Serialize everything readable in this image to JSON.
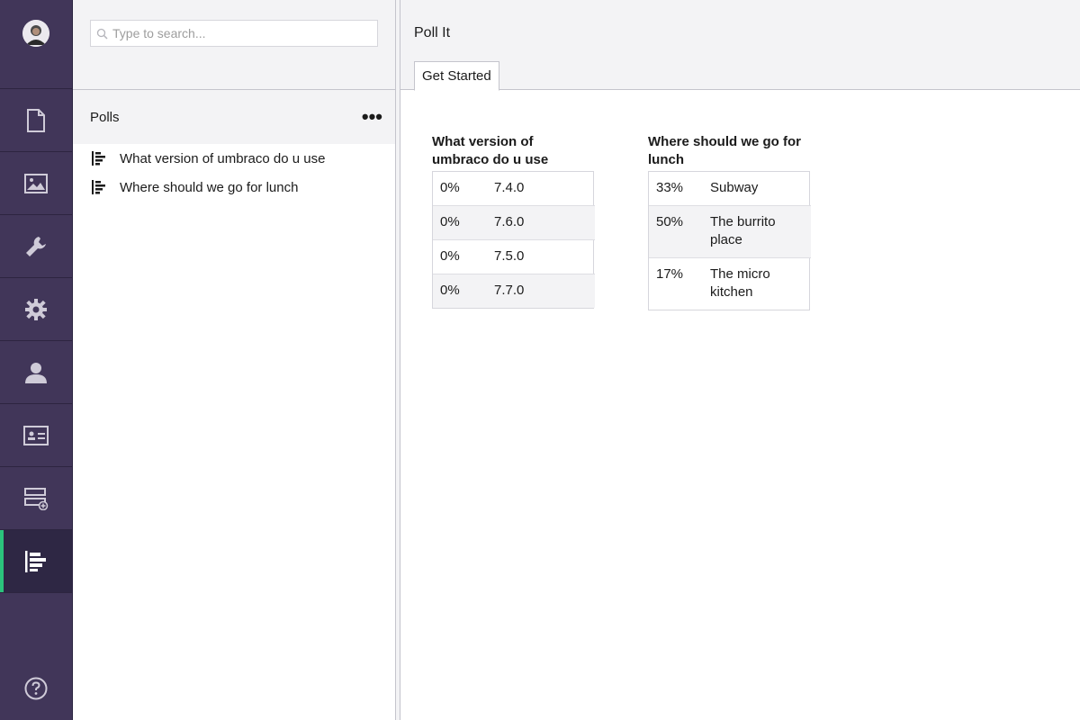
{
  "rail": {
    "items": [
      {
        "name": "content",
        "icon": "document-icon"
      },
      {
        "name": "media",
        "icon": "image-icon"
      },
      {
        "name": "settings",
        "icon": "wrench-icon"
      },
      {
        "name": "developer",
        "icon": "gear-icon"
      },
      {
        "name": "users",
        "icon": "user-icon"
      },
      {
        "name": "members",
        "icon": "id-card-icon"
      },
      {
        "name": "forms",
        "icon": "form-add-icon"
      },
      {
        "name": "polls",
        "icon": "poll-chart-icon",
        "active": true
      }
    ],
    "help_icon": "help-icon",
    "accent_color": "#2bc37c",
    "background_color": "#413659"
  },
  "tree": {
    "search_placeholder": "Type to search...",
    "section_title": "Polls",
    "menu_label": "•••",
    "nodes": [
      {
        "label": "What version of umbraco do u use"
      },
      {
        "label": "Where should we go for lunch"
      }
    ]
  },
  "editor": {
    "title": "Poll It",
    "tabs": [
      {
        "label": "Get Started"
      }
    ]
  },
  "polls": [
    {
      "question": "What version of umbraco do u use",
      "answers": [
        {
          "percent": "0%",
          "text": "7.4.0"
        },
        {
          "percent": "0%",
          "text": "7.6.0"
        },
        {
          "percent": "0%",
          "text": "7.5.0"
        },
        {
          "percent": "0%",
          "text": "7.7.0"
        }
      ]
    },
    {
      "question": "Where should we go for lunch",
      "answers": [
        {
          "percent": "33%",
          "text": "Subway"
        },
        {
          "percent": "50%",
          "text": "The burrito place"
        },
        {
          "percent": "17%",
          "text": "The micro kitchen"
        }
      ]
    }
  ]
}
